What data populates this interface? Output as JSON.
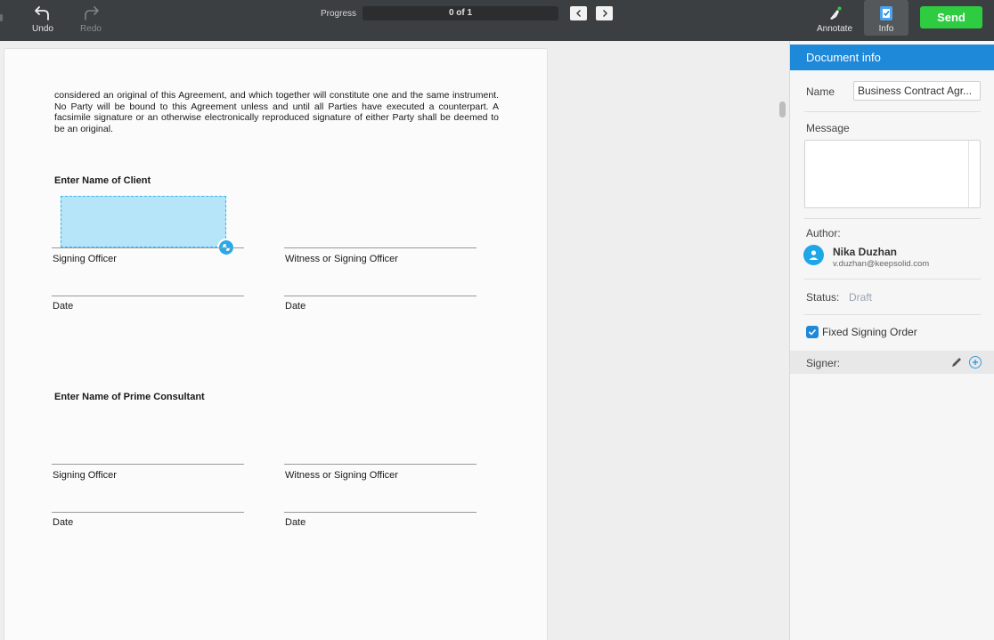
{
  "toolbar": {
    "undo_label": "Undo",
    "redo_label": "Redo",
    "progress_label": "Progress",
    "progress_text": "0 of 1",
    "progress_fraction": 0,
    "annotate_label": "Annotate",
    "info_label": "Info",
    "send_label": "Send"
  },
  "document": {
    "paragraph": "considered an original of this Agreement, and which together will constitute one and the same instrument.  No Party will be bound to this Agreement unless and until all Parties have executed a counterpart. A facsimile signature or an otherwise electronically reproduced signature of either Party shall be deemed to be an original.",
    "client_heading": "Enter Name of Client",
    "consultant_heading": "Enter Name of Prime Consultant",
    "signing_officer": "Signing Officer",
    "witness": "Witness or Signing Officer",
    "date": "Date"
  },
  "panel": {
    "title": "Document info",
    "name_label": "Name",
    "name_value": "Business Contract  Agr...",
    "message_label": "Message",
    "author_label": "Author:",
    "author_name": "Nika Duzhan",
    "author_email": "v.duzhan@keepsolid.com",
    "status_label": "Status:",
    "status_value": "Draft",
    "fixed_order_label": "Fixed Signing Order",
    "fixed_order_checked": true,
    "signer_label": "Signer:"
  },
  "colors": {
    "toolbar_bg": "#3c3f41",
    "accent_blue": "#1e88d9",
    "send_green": "#2ecc40",
    "field_fill": "#b6e4f8"
  }
}
